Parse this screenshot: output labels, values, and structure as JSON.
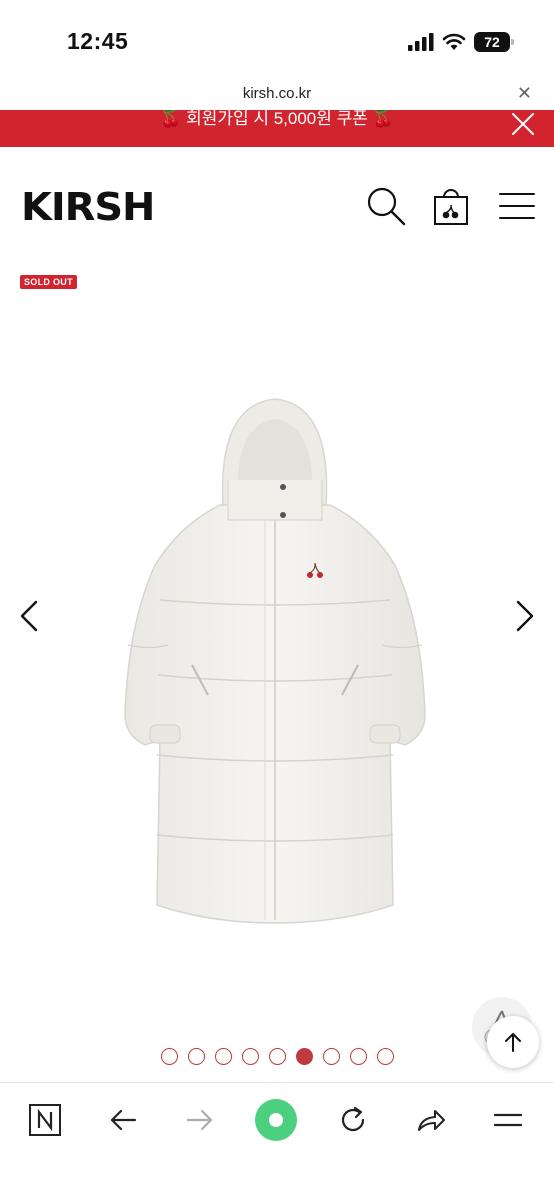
{
  "status": {
    "time": "12:45",
    "battery": "72"
  },
  "browser": {
    "url": "kirsh.co.kr",
    "close_icon": "close-icon"
  },
  "promo": {
    "text": "🍒 회원가입 시 5,000원 쿠폰 🍒"
  },
  "header": {
    "logo": "KIRSH",
    "icons": [
      "search-icon",
      "shopping-bag-icon",
      "hamburger-menu-icon"
    ]
  },
  "product": {
    "badge": "SOLD OUT",
    "image": "white long padded down coat with hood and cherry logo"
  },
  "carousel": {
    "total": 9,
    "active_index": 5
  },
  "colors": {
    "brand_red": "#d2242f",
    "dot_red": "#c0393f",
    "nav_green": "#4cd080"
  }
}
